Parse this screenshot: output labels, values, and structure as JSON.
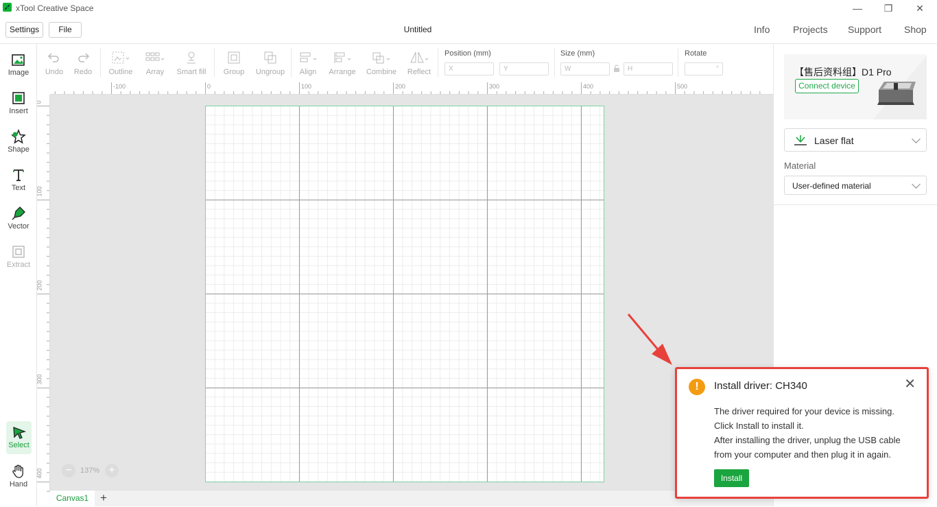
{
  "window": {
    "app_title": "xTool Creative Space",
    "minimize": "—",
    "restore": "❐",
    "close": "✕"
  },
  "menu": {
    "settings_label": "Settings",
    "file_label": "File",
    "doc_title": "Untitled",
    "links": [
      "Info",
      "Projects",
      "Support",
      "Shop"
    ]
  },
  "left_tools": [
    {
      "label": "Image",
      "icon": "image-icon",
      "enabled": true
    },
    {
      "label": "Insert",
      "icon": "insert-icon",
      "enabled": true
    },
    {
      "label": "Shape",
      "icon": "shape-icon",
      "enabled": true
    },
    {
      "label": "Text",
      "icon": "text-icon",
      "enabled": true
    },
    {
      "label": "Vector",
      "icon": "vector-pen-icon",
      "enabled": true
    },
    {
      "label": "Extract",
      "icon": "extract-icon",
      "enabled": false
    },
    {
      "label": "Select",
      "icon": "select-cursor-icon",
      "enabled": true,
      "active": true
    },
    {
      "label": "Hand",
      "icon": "hand-icon",
      "enabled": true
    }
  ],
  "edit_tools": {
    "undo": "Undo",
    "redo": "Redo",
    "outline": "Outline",
    "array": "Array",
    "smart_fill": "Smart fill",
    "group": "Group",
    "ungroup": "Ungroup",
    "align": "Align",
    "arrange": "Arrange",
    "combine": "Combine",
    "reflect": "Reflect",
    "position_label": "Position (mm)",
    "x_placeholder": "X",
    "y_placeholder": "Y",
    "size_label": "Size (mm)",
    "w_placeholder": "W",
    "h_placeholder": "H",
    "rotate_label": "Rotate",
    "rotate_unit": "°"
  },
  "ruler": {
    "top_ticks": [
      "-100",
      "0",
      "100",
      "200",
      "300",
      "400",
      "500"
    ],
    "left_ticks": [
      "0",
      "100",
      "200",
      "300",
      "400"
    ]
  },
  "zoom": {
    "value": "137%",
    "minus": "−",
    "plus": "+"
  },
  "tabs": {
    "canvas1": "Canvas1",
    "add": "+"
  },
  "device": {
    "name": "【售后资料组】D1 Pro",
    "connect_label": "Connect device",
    "mode": "Laser flat",
    "material_title": "Material",
    "material": "User-defined material"
  },
  "dialog": {
    "icon": "!",
    "title": "Install driver: CH340",
    "close": "✕",
    "lines": [
      "The driver required for your device is missing.",
      "Click Install to install it.",
      "After installing the driver, unplug the USB cable",
      "from your computer and then plug it in again."
    ],
    "install_label": "Install"
  },
  "colors": {
    "accent": "#1aa53f",
    "annotation": "#e8413c",
    "warning": "#f39c12"
  }
}
